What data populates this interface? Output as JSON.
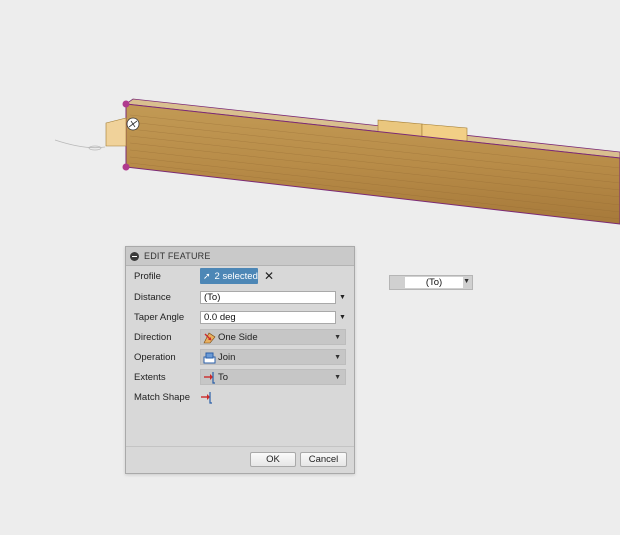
{
  "panel": {
    "title": "EDIT FEATURE",
    "rows": {
      "profile": {
        "label": "Profile",
        "value": "2 selected"
      },
      "distance": {
        "label": "Distance",
        "value": "(To)"
      },
      "taper": {
        "label": "Taper Angle",
        "value": "0.0 deg"
      },
      "direction": {
        "label": "Direction",
        "value": "One Side",
        "icon": "one-side-icon"
      },
      "operation": {
        "label": "Operation",
        "value": "Join",
        "icon": "join-icon"
      },
      "extents": {
        "label": "Extents",
        "value": "To",
        "icon": "to-extent-icon"
      },
      "match_shape": {
        "label": "Match Shape",
        "icon": "match-shape-icon"
      }
    },
    "buttons": {
      "ok": "OK",
      "cancel": "Cancel"
    }
  },
  "floating_input": {
    "value": "(To)"
  },
  "colors": {
    "selection_blue": "#4d87b6",
    "point_magenta": "#b03a8e",
    "edge_purple": "#7b2a76",
    "icon_red": "#cc2a2a",
    "icon_blue": "#2a5fa8"
  }
}
